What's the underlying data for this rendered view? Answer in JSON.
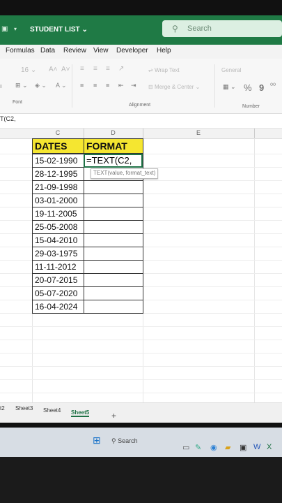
{
  "app": {
    "doc_title": "STUDENT LIST",
    "search_placeholder": "Search"
  },
  "menu": [
    "Formulas",
    "Data",
    "Review",
    "View",
    "Developer",
    "Help"
  ],
  "ribbon": {
    "font_size": "16",
    "wrap_text": "Wrap Text",
    "merge_center": "Merge & Center",
    "number_format": "General",
    "percent": "%",
    "comma": "9",
    "groups": {
      "font": "Font",
      "alignment": "Alignment",
      "number": "Number"
    }
  },
  "formula_bar": {
    "text": "T(C2,"
  },
  "columns": [
    "C",
    "D",
    "E"
  ],
  "table": {
    "headers": [
      "DATES",
      "FORMAT"
    ],
    "dates": [
      "15-02-1990",
      "28-12-1995",
      "21-09-1998",
      "03-01-2000",
      "19-11-2005",
      "25-05-2008",
      "15-04-2010",
      "29-03-1975",
      "11-11-2012",
      "20-07-2015",
      "05-07-2020",
      "16-04-2024"
    ],
    "active_cell_text": "=TEXT(C2,",
    "tooltip": "TEXT(value, format_text)"
  },
  "sheet_tabs": [
    "t2",
    "Sheet3",
    "Sheet4",
    "Sheet5"
  ],
  "active_sheet": "Sheet5",
  "taskbar": {
    "search": "Search"
  },
  "colors": {
    "title_green": "#1f7a45",
    "header_yellow": "#f5e630",
    "active_border": "#1e7145"
  }
}
